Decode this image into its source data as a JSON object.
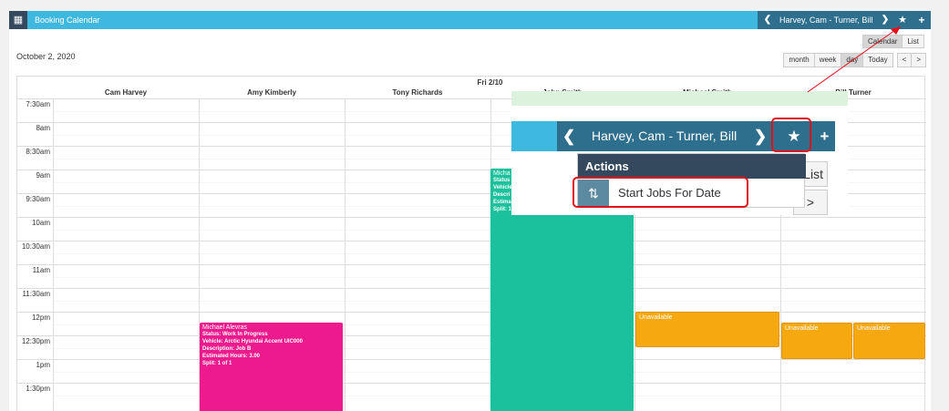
{
  "header": {
    "title": "Booking Calendar",
    "range": "Harvey, Cam - Turner, Bill",
    "icons": {
      "calendar": "calendar-icon",
      "prev": "chevron-left-icon",
      "next": "chevron-right-icon",
      "star": "star-icon",
      "add": "plus-icon"
    }
  },
  "toolbar": {
    "date": "October 2, 2020",
    "modes": [
      {
        "label": "Calendar",
        "active": true
      },
      {
        "label": "List",
        "active": false
      }
    ],
    "views": [
      {
        "label": "month"
      },
      {
        "label": "week"
      },
      {
        "label": "day",
        "active": true
      },
      {
        "label": "Today"
      }
    ],
    "prev": "<",
    "next": ">"
  },
  "calendar": {
    "day": "Fri 2/10",
    "resources": [
      "Cam Harvey",
      "Amy Kimberly",
      "Tony Richards",
      "John Smith",
      "Michael Smith",
      "Bill Turner"
    ],
    "times": [
      "7:30am",
      "8am",
      "8:30am",
      "9am",
      "9:30am",
      "10am",
      "10:30am",
      "11am",
      "11:30am",
      "12pm",
      "12:30pm",
      "1pm",
      "1:30pm"
    ],
    "events": {
      "pink": {
        "title": "Michael Alevras",
        "status": "Status: Work In Progress",
        "vehicle": "Vehicle: Arctic Hyundai Accent UIC000",
        "description": "Description: Job B",
        "hours": "Estimated Hours: 3.00",
        "split": "Split: 1 of 1"
      },
      "teal": {
        "title": "Micha",
        "status": "Status",
        "vehicle": "Vehicle",
        "description": "Descri",
        "hours": "Estima",
        "split": "Split: 1 of 1"
      },
      "unavailable": "Unavailable"
    }
  },
  "zoom": {
    "range": "Harvey, Cam - Turner, Bill",
    "menu_header": "Actions",
    "menu_item": "Start Jobs For Date",
    "list_fragment": "List",
    "next_fragment": ">",
    "item_icon": "shuffle-icon"
  },
  "colors": {
    "header": "#3fb8e0",
    "nav": "#2f6f8e",
    "pink": "#ec1a8c",
    "teal": "#1bc19c",
    "orange": "#f5a810",
    "highlight": "#e3101a"
  }
}
